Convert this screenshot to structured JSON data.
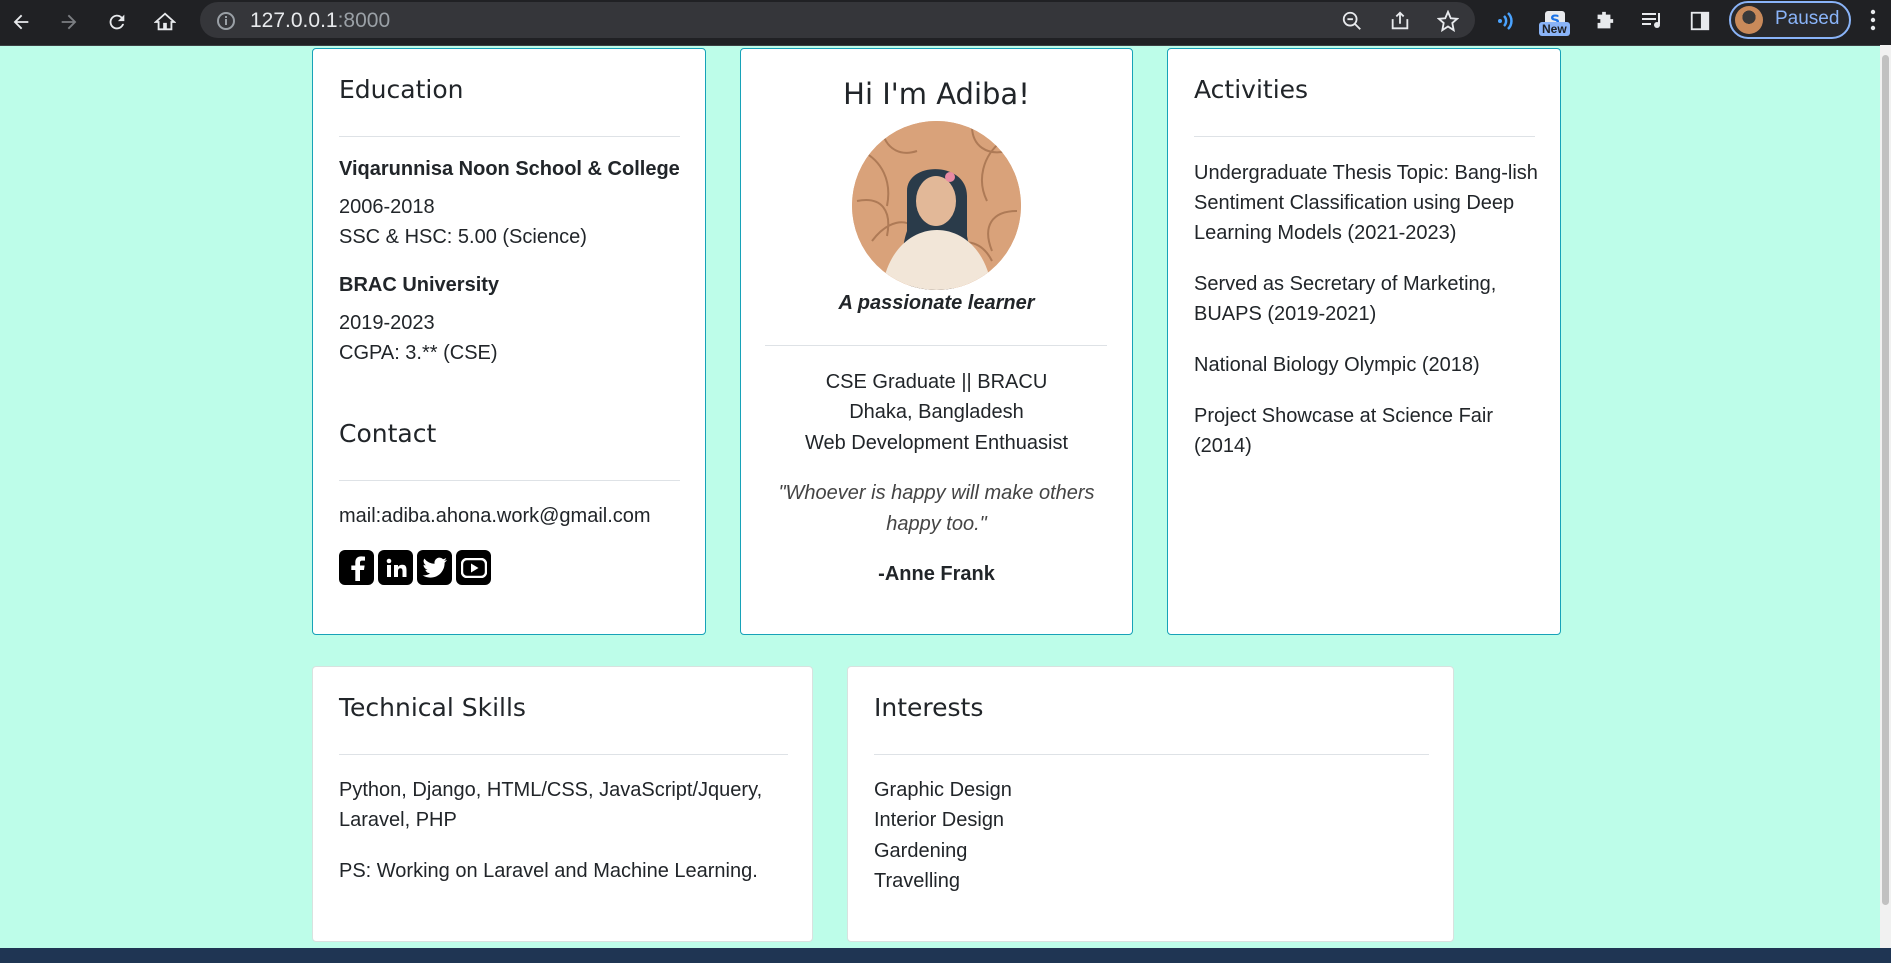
{
  "browser": {
    "url_host": "127.0.0.1",
    "url_port": ":8000",
    "new_badge": "New",
    "profile_label": "Paused"
  },
  "education": {
    "title": "Education",
    "entries": [
      {
        "school": "Viqarunnisa Noon School & College",
        "years": "2006-2018",
        "detail": "SSC & HSC: 5.00 (Science)"
      },
      {
        "school": "BRAC University",
        "years": "2019-2023",
        "detail": "CGPA: 3.** (CSE)"
      }
    ]
  },
  "contact": {
    "title": "Contact",
    "email": "mail:adiba.ahona.work@gmail.com"
  },
  "profile": {
    "greeting": "Hi I'm Adiba!",
    "tagline": "A passionate learner",
    "lines": [
      "CSE Graduate || BRACU",
      "Dhaka, Bangladesh",
      "Web Development Enthuasist"
    ],
    "quote_line1": "\"Whoever is happy will make others",
    "quote_line2": "happy too.\"",
    "quote_author": "-Anne Frank"
  },
  "activities": {
    "title": "Activities",
    "items": [
      {
        "l1": "Undergraduate Thesis Topic: Bang-lish",
        "l2": "Sentiment Classification using Deep",
        "l3": "Learning Models (2021-2023)"
      },
      {
        "l1": "Served as Secretary of Marketing,",
        "l2": "BUAPS (2019-2021)"
      },
      {
        "l1": "National Biology Olympic (2018)"
      },
      {
        "l1": "Project Showcase at Science Fair",
        "l2": "(2014)"
      }
    ]
  },
  "skills": {
    "title": "Technical Skills",
    "line1": "Python, Django, HTML/CSS, JavaScript/Jquery,",
    "line2": "Laravel, PHP",
    "note": "PS: Working on Laravel and Machine Learning."
  },
  "interests": {
    "title": "Interests",
    "items": [
      "Graphic Design",
      "Interior Design",
      "Gardening",
      "Travelling"
    ]
  }
}
